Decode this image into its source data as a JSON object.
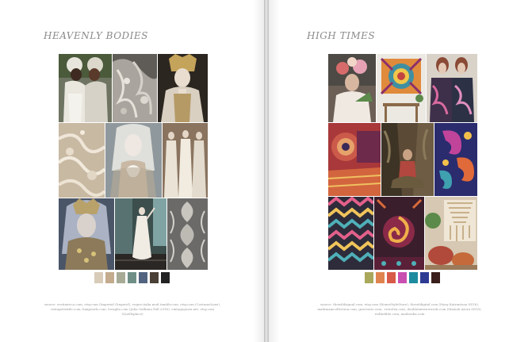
{
  "left_page": {
    "title": "HEAVENLY BODIES",
    "swatches": [
      "#d8cbb8",
      "#c4ab8d",
      "#a7aa95",
      "#6f8f86",
      "#52647f",
      "#4b4035",
      "#222222"
    ],
    "credits": "source: vestiaireco.com, etsy.com (Imperial Gingerol), vogue.italia.mod.tumblr.com, etsy.com (CostumeLuxe), vintagetextile.com, luxipearls.com, lovaglio.com (Julia Gallianu Fall 2016), vintagegown.net, etsy.com (Quelleplace)"
  },
  "right_page": {
    "title": "HIGH TIMES",
    "swatches": [
      "#a9a85b",
      "#e0844f",
      "#d85b4a",
      "#c94fb1",
      "#1e8c9f",
      "#2d3b93",
      "#3a1f1a"
    ],
    "credits": "source: thewildsignal.com, etsy.com (HomeStyleStore), threeldigital.com (Mary Katrantzou SS16), mahimamcollection.com, graveoris.com, -retrolex.com, doubleinteriorwork.com (Manish Arora SS16), redbubble.com, madrasha.com"
  }
}
